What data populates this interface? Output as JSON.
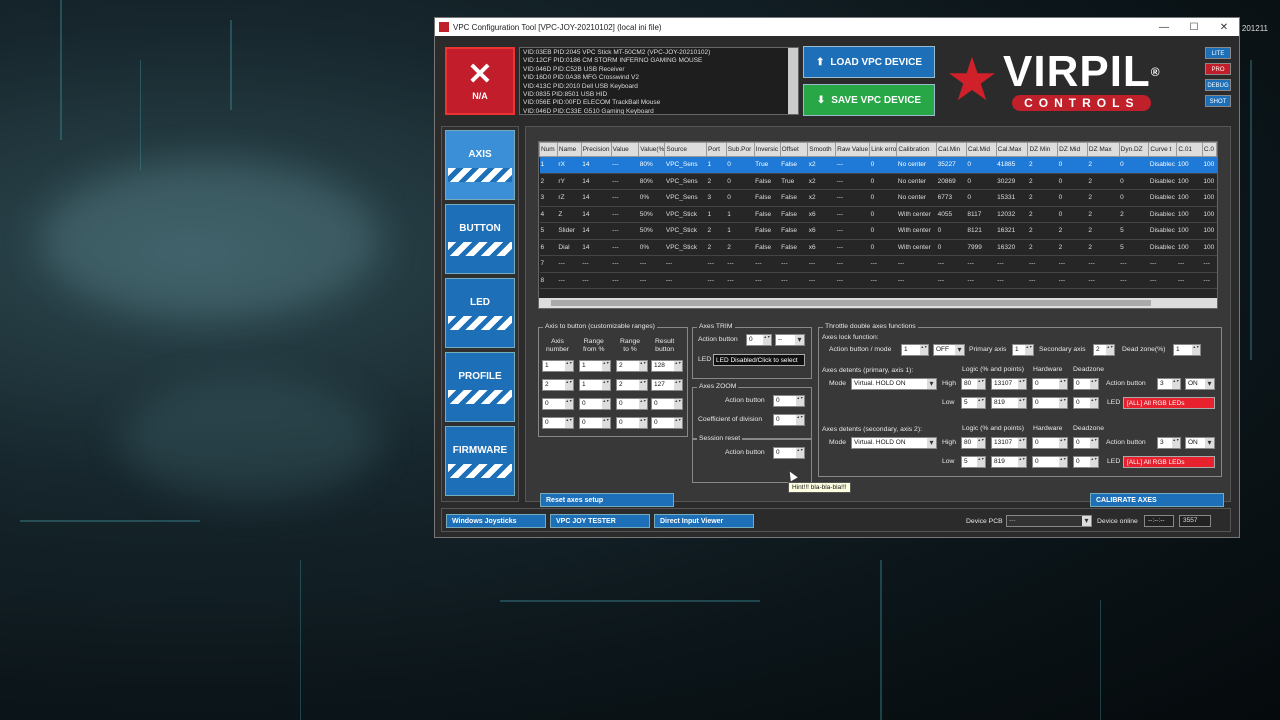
{
  "desktop": {
    "clock_fragment": "201211"
  },
  "window": {
    "title": "VPC Configuration Tool [VPC-JOY-20210102] (local ini file)",
    "min": "—",
    "max": "☐",
    "close": "✕"
  },
  "status": {
    "icon": "✕",
    "label": "N/A"
  },
  "devices": [
    "VID:03EB PID:2045 VPC Stick MT-50CM2 (VPC-JOY-20210102)",
    "VID:12CF PID:0186 CM STORM INFERNO GAMING MOUSE",
    "VID:046D PID:C52B USB Receiver",
    "VID:16D0 PID:0A38 MFG Crosswind V2",
    "VID:413C PID:2010 Dell USB Keyboard",
    "VID:0835 PID:8501 USB HID",
    "VID:056E PID:00FD ELECOM TrackBall Mouse",
    "VID:046D PID:C33E G510 Gaming Keyboard"
  ],
  "actions": {
    "load": "LOAD VPC DEVICE",
    "save": "SAVE VPC DEVICE",
    "load_icon": "⬆",
    "save_icon": "⬇"
  },
  "logo": {
    "name": "VIRPIL",
    "reg": "®",
    "sub": "CONTROLS",
    "star": "★"
  },
  "modes": [
    "LITE",
    "PRO",
    "DEBUG",
    "SHOT"
  ],
  "nav": [
    "AXIS",
    "BUTTON",
    "LED",
    "PROFILE",
    "FIRMWARE"
  ],
  "table": {
    "columns": [
      "Num",
      "Name",
      "Precision",
      "Value",
      "Value(%",
      "Source",
      "Port",
      "Sub.Por",
      "Inversic",
      "Offset",
      "Smooth",
      "Raw Value",
      "Link erro",
      "Calibration",
      "Cal.Min",
      "Cal.Mid",
      "Cal.Max",
      "DZ Min",
      "DZ Mid",
      "DZ Max",
      "Dyn.DZ",
      "Curve t",
      "C.01",
      "C.0"
    ],
    "rows": [
      [
        "1",
        "rX",
        "14",
        "---",
        "80%",
        "VPC_Sens",
        "1",
        "0",
        "True",
        "False",
        "x2",
        "---",
        "0",
        "No center",
        "35227",
        "0",
        "41885",
        "2",
        "0",
        "2",
        "0",
        "Disablec",
        "100",
        "100"
      ],
      [
        "2",
        "rY",
        "14",
        "---",
        "80%",
        "VPC_Sens",
        "2",
        "0",
        "False",
        "True",
        "x2",
        "---",
        "0",
        "No center",
        "20869",
        "0",
        "30229",
        "2",
        "0",
        "2",
        "0",
        "Disablec",
        "100",
        "100"
      ],
      [
        "3",
        "rZ",
        "14",
        "---",
        "0%",
        "VPC_Sens",
        "3",
        "0",
        "False",
        "False",
        "x2",
        "---",
        "0",
        "No center",
        "6773",
        "0",
        "15331",
        "2",
        "0",
        "2",
        "0",
        "Disablec",
        "100",
        "100"
      ],
      [
        "4",
        "Z",
        "14",
        "---",
        "50%",
        "VPC_Stick",
        "1",
        "1",
        "False",
        "False",
        "x6",
        "---",
        "0",
        "With center",
        "4055",
        "8117",
        "12032",
        "2",
        "0",
        "2",
        "2",
        "Disablec",
        "100",
        "100"
      ],
      [
        "5",
        "Slider",
        "14",
        "---",
        "50%",
        "VPC_Stick",
        "2",
        "1",
        "False",
        "False",
        "x6",
        "---",
        "0",
        "With center",
        "0",
        "8121",
        "16321",
        "2",
        "2",
        "2",
        "5",
        "Disablec",
        "100",
        "100"
      ],
      [
        "6",
        "Dial",
        "14",
        "---",
        "0%",
        "VPC_Stick",
        "2",
        "2",
        "False",
        "False",
        "x6",
        "---",
        "0",
        "With center",
        "0",
        "7999",
        "16320",
        "2",
        "2",
        "2",
        "5",
        "Disablec",
        "100",
        "100"
      ],
      [
        "7",
        "---",
        "---",
        "---",
        "---",
        "---",
        "---",
        "---",
        "---",
        "---",
        "---",
        "---",
        "---",
        "---",
        "---",
        "---",
        "---",
        "---",
        "---",
        "---",
        "---",
        "---",
        "---",
        "---"
      ],
      [
        "8",
        "---",
        "---",
        "---",
        "---",
        "---",
        "---",
        "---",
        "---",
        "---",
        "---",
        "---",
        "---",
        "---",
        "---",
        "---",
        "---",
        "---",
        "---",
        "---",
        "---",
        "---",
        "---",
        "---"
      ]
    ]
  },
  "atb": {
    "title": "Axis to button (customizable ranges)",
    "headers": [
      "Axis\nnumber",
      "Range\nfrom %",
      "Range\nto %",
      "Result\nbutton"
    ],
    "rows": [
      [
        "1",
        "1",
        "2",
        "128"
      ],
      [
        "2",
        "1",
        "2",
        "127"
      ],
      [
        "0",
        "0",
        "0",
        "0"
      ],
      [
        "0",
        "0",
        "0",
        "0"
      ]
    ]
  },
  "trim": {
    "title": "Axes TRIM",
    "action_label": "Action button",
    "action_value": "0",
    "combo": "--",
    "led_label": "LED",
    "led_value": "LED Disabled/Click to select"
  },
  "zoom": {
    "title": "Axes ZOOM",
    "action_label": "Action button",
    "action_value": "0",
    "coef_label": "Coefficient of division",
    "coef_value": "0"
  },
  "reset": {
    "title": "Session reset",
    "action_label": "Action button",
    "action_value": "0",
    "hint": "Hint!!! bla-bla-bla!!!"
  },
  "throttle": {
    "title": "Throttle double axes functions",
    "lock_label": "Axes lock function:",
    "action_mode_label": "Action button / mode",
    "action_value": "1",
    "mode_value": "OFF",
    "primary_label": "Primary axis",
    "primary_value": "1",
    "secondary_label": "Secondary axis",
    "secondary_value": "2",
    "dz_label": "Dead zone(%)",
    "dz_value": "1",
    "detents": [
      {
        "title": "Axes detents (primary, axis 1):",
        "logic_label": "Logic (% and points)",
        "hw_label": "Hardware",
        "dz_label": "Deadzone",
        "mode_label": "Mode",
        "mode": "Virtual. HOLD ON",
        "high_label": "High",
        "high_pct": "80",
        "high_pts": "13107",
        "high_hw": "0",
        "high_dz": "0",
        "low_label": "Low",
        "low_pct": "5",
        "low_pts": "819",
        "low_hw": "0",
        "low_dz": "0",
        "ab_label": "Action button",
        "ab_value": "3",
        "ab_mode": "ON",
        "led_label": "LED",
        "led_value": "[ALL] All RGB LEDs"
      },
      {
        "title": "Axes detents (secondary, axis 2):",
        "logic_label": "Logic (% and points)",
        "hw_label": "Hardware",
        "dz_label": "Deadzone",
        "mode_label": "Mode",
        "mode": "Virtual. HOLD ON",
        "high_label": "High",
        "high_pct": "80",
        "high_pts": "13107",
        "high_hw": "0",
        "high_dz": "0",
        "low_label": "Low",
        "low_pct": "5",
        "low_pts": "819",
        "low_hw": "0",
        "low_dz": "0",
        "ab_label": "Action button",
        "ab_value": "3",
        "ab_mode": "ON",
        "led_label": "LED",
        "led_value": "[ALL] All RGB LEDs"
      }
    ]
  },
  "buttons": {
    "reset_setup": "Reset axes setup",
    "calibrate": "CALIBRATE AXES"
  },
  "bottom": {
    "win_joy": "Windows Joysticks",
    "tester": "VPC JOY TESTER",
    "di_viewer": "Direct Input Viewer",
    "pcb_label": "Device PCB",
    "pcb_value": "---",
    "online_label": "Device online",
    "online_value": "--:--:--",
    "online_count": "3557"
  }
}
